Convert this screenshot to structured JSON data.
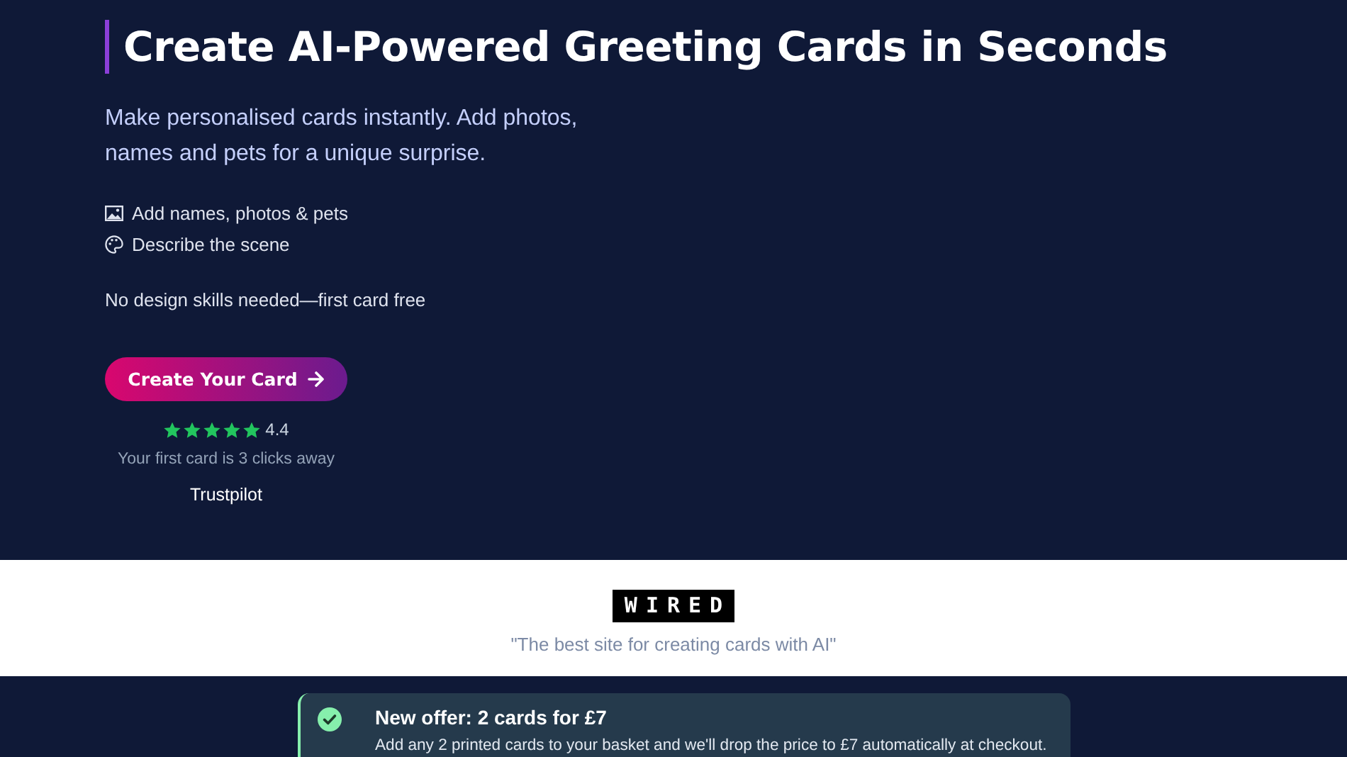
{
  "hero": {
    "title": "Create AI-Powered Greeting Cards in Seconds",
    "subtitle": "Make personalised cards instantly. Add photos,\nnames and pets for a unique surprise.",
    "features": [
      {
        "kind": "image",
        "label": "Add names, photos & pets"
      },
      {
        "kind": "palette",
        "label": "Describe the scene"
      }
    ],
    "note": "No design skills needed—first card free",
    "cta": "Create Your Card",
    "stars": 5,
    "rating": "4.4",
    "clicks_note": "Your first card is 3 clicks away",
    "review_site": "Trustpilot"
  },
  "press": {
    "logo": "WIRED",
    "quote": "\"The best site for creating cards with AI\""
  },
  "offer": {
    "title": "New offer: 2 cards for £7",
    "text": "Add any 2 printed cards to your basket and we'll drop the price to £7 automatically at checkout."
  }
}
